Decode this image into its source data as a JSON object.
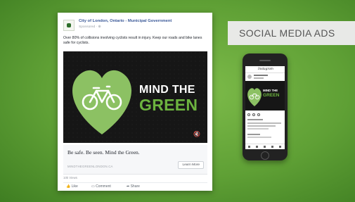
{
  "ad": {
    "page_name": "City of London, Ontario - Municipal Government",
    "sponsored": "Sponsored · ⊕",
    "post_text": "Over 80% of collisions involving cyclists result in injury. Keep our roads and bike lanes safe for cyclists.",
    "image_line1": "MIND THE",
    "image_line2": "GREEN",
    "mute_icon": "🔇",
    "headline": "Be safe. Be seen. Mind the Green.",
    "url": "MINDTHEGREENLONDON.CA",
    "cta": "Learn More",
    "views": "10k Views",
    "actions": {
      "like": "Like",
      "comment": "Comment",
      "share": "Share"
    }
  },
  "badge": {
    "label": "SOCIAL MEDIA ADS"
  },
  "phone": {
    "app_title": "Instagram",
    "image_line1": "MIND THE",
    "image_line2": "GREEN"
  },
  "colors": {
    "background": "#5fa035",
    "brand_green": "#6cb33f",
    "heart_green": "#8cc163",
    "facebook_blue": "#3b5998"
  },
  "icons": [
    "page-logo",
    "heart-bicycle-icon",
    "mute-icon",
    "like-icon",
    "comment-icon",
    "share-icon"
  ]
}
